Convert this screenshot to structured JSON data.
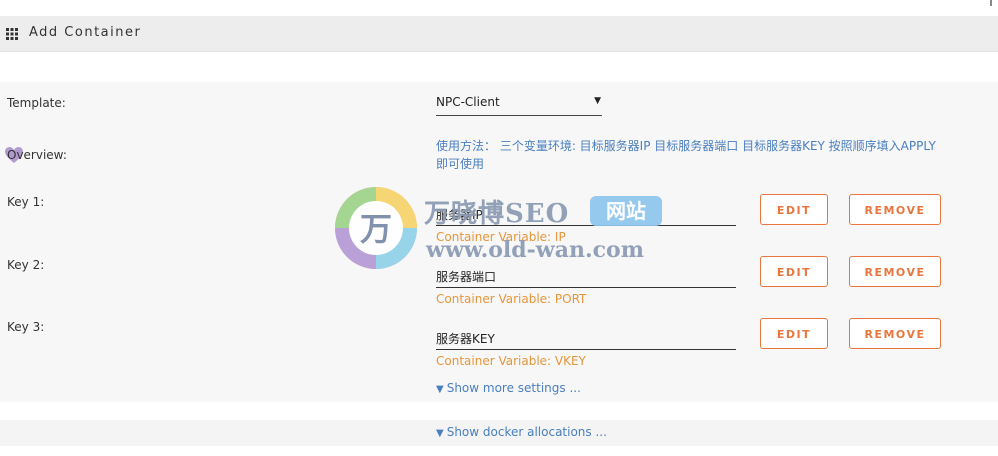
{
  "header": {
    "title": "Add Container",
    "icon": "grid-icon"
  },
  "form": {
    "template_label": "Template:",
    "template_value": "NPC-Client",
    "overview_label": "Overview:",
    "overview_text": "使用方法： 三个变量环境: 目标服务器IP 目标服务器端口 目标服务器KEY 按照顺序填入APPLY 即可使用",
    "keys": [
      {
        "label": "Key 1:",
        "value": "服务器IP",
        "container_variable": "Container Variable: IP",
        "edit": "EDIT",
        "remove": "REMOVE"
      },
      {
        "label": "Key 2:",
        "value": "服务器端口",
        "container_variable": "Container Variable: PORT",
        "edit": "EDIT",
        "remove": "REMOVE"
      },
      {
        "label": "Key 3:",
        "value": "服务器KEY",
        "container_variable": "Container Variable: VKEY",
        "edit": "EDIT",
        "remove": "REMOVE"
      }
    ],
    "show_more": "Show more settings ...",
    "show_docker": "Show docker allocations ..."
  },
  "watermark": {
    "line1": "万晓博SEO",
    "badge": "网站",
    "line2": "www.old-wan.com",
    "logo_char": "万"
  },
  "colors": {
    "accent_orange": "#e8763e",
    "link_blue": "#4a7fbf",
    "variable_orange": "#e6963a"
  }
}
